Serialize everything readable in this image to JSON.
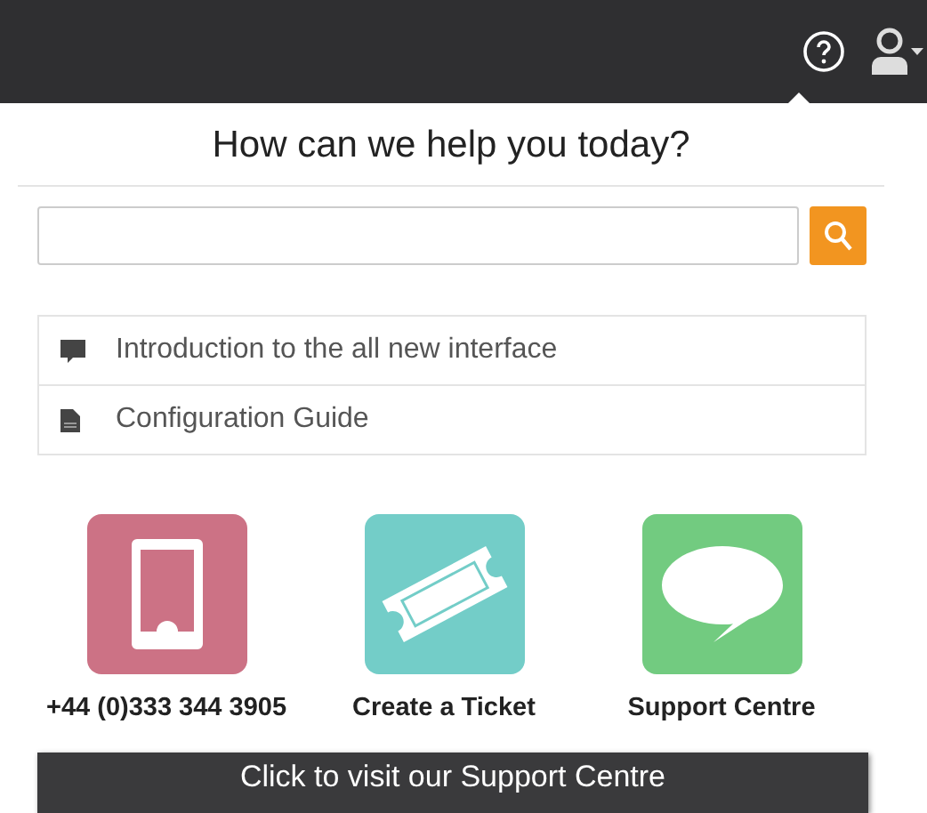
{
  "panel": {
    "title": "How can we help you today?"
  },
  "links": [
    {
      "kind": "comment",
      "label": "Introduction to the all new interface"
    },
    {
      "kind": "document",
      "label": "Configuration Guide"
    }
  ],
  "contacts": [
    {
      "kind": "phone",
      "label": "+44 (0)333 344 3905",
      "color": "#cc7285"
    },
    {
      "kind": "ticket",
      "label": "Create a Ticket",
      "color": "#73cdc8"
    },
    {
      "kind": "chat",
      "label": "Support Centre",
      "color": "#72cb80"
    }
  ],
  "cta": {
    "label": "Click to visit our Support Centre"
  }
}
